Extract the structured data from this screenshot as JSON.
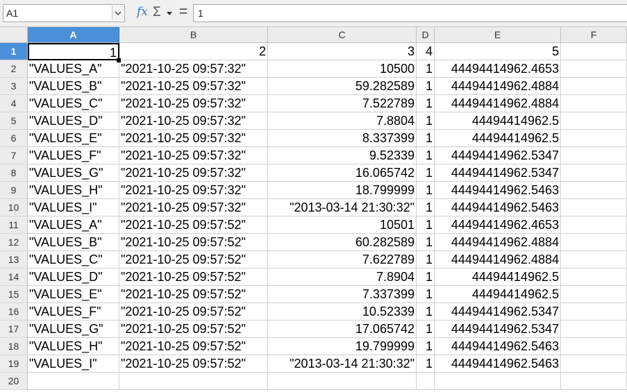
{
  "namebox": {
    "value": "A1",
    "dropdown_icon": "chevron-down-icon"
  },
  "formula": {
    "fx_icon": "function-wizard-icon",
    "fx_label": "fx",
    "sigma_icon": "sum-icon",
    "sigma_label": "Σ",
    "equals_icon": "formula-icon",
    "equals_label": "=",
    "value": "1"
  },
  "columns": [
    "A",
    "B",
    "C",
    "D",
    "E",
    "F"
  ],
  "rows": [
    {
      "num": "1",
      "cells": [
        "1",
        "2",
        "3",
        "4",
        "5",
        ""
      ]
    },
    {
      "num": "2",
      "cells": [
        "\"VALUES_A\"",
        "\"2021-10-25 09:57:32\"",
        "10500",
        "1",
        "44494414962.4653",
        ""
      ]
    },
    {
      "num": "3",
      "cells": [
        "\"VALUES_B\"",
        "\"2021-10-25 09:57:32\"",
        "59.282589",
        "1",
        "44494414962.4884",
        ""
      ]
    },
    {
      "num": "4",
      "cells": [
        "\"VALUES_C\"",
        "\"2021-10-25 09:57:32\"",
        "7.522789",
        "1",
        "44494414962.4884",
        ""
      ]
    },
    {
      "num": "5",
      "cells": [
        "\"VALUES_D\"",
        "\"2021-10-25 09:57:32\"",
        "7.8804",
        "1",
        "44494414962.5",
        ""
      ]
    },
    {
      "num": "6",
      "cells": [
        "\"VALUES_E\"",
        "\"2021-10-25 09:57:32\"",
        "8.337399",
        "1",
        "44494414962.5",
        ""
      ]
    },
    {
      "num": "7",
      "cells": [
        "\"VALUES_F\"",
        "\"2021-10-25 09:57:32\"",
        "9.52339",
        "1",
        "44494414962.5347",
        ""
      ]
    },
    {
      "num": "8",
      "cells": [
        "\"VALUES_G\"",
        "\"2021-10-25 09:57:32\"",
        "16.065742",
        "1",
        "44494414962.5347",
        ""
      ]
    },
    {
      "num": "9",
      "cells": [
        "\"VALUES_H\"",
        "\"2021-10-25 09:57:32\"",
        "18.799999",
        "1",
        "44494414962.5463",
        ""
      ]
    },
    {
      "num": "10",
      "cells": [
        "\"VALUES_I\"",
        "\"2021-10-25 09:57:32\"",
        "\"2013-03-14 21:30:32\"",
        "1",
        "44494414962.5463",
        ""
      ]
    },
    {
      "num": "11",
      "cells": [
        "\"VALUES_A\"",
        "\"2021-10-25 09:57:52\"",
        "10501",
        "1",
        "44494414962.4653",
        ""
      ]
    },
    {
      "num": "12",
      "cells": [
        "\"VALUES_B\"",
        "\"2021-10-25 09:57:52\"",
        "60.282589",
        "1",
        "44494414962.4884",
        ""
      ]
    },
    {
      "num": "13",
      "cells": [
        "\"VALUES_C\"",
        "\"2021-10-25 09:57:52\"",
        "7.622789",
        "1",
        "44494414962.4884",
        ""
      ]
    },
    {
      "num": "14",
      "cells": [
        "\"VALUES_D\"",
        "\"2021-10-25 09:57:52\"",
        "7.8904",
        "1",
        "44494414962.5",
        ""
      ]
    },
    {
      "num": "15",
      "cells": [
        "\"VALUES_E\"",
        "\"2021-10-25 09:57:52\"",
        "7.337399",
        "1",
        "44494414962.5",
        ""
      ]
    },
    {
      "num": "16",
      "cells": [
        "\"VALUES_F\"",
        "\"2021-10-25 09:57:52\"",
        "10.52339",
        "1",
        "44494414962.5347",
        ""
      ]
    },
    {
      "num": "17",
      "cells": [
        "\"VALUES_G\"",
        "\"2021-10-25 09:57:52\"",
        "17.065742",
        "1",
        "44494414962.5347",
        ""
      ]
    },
    {
      "num": "18",
      "cells": [
        "\"VALUES_H\"",
        "\"2021-10-25 09:57:52\"",
        "19.799999",
        "1",
        "44494414962.5463",
        ""
      ]
    },
    {
      "num": "19",
      "cells": [
        "\"VALUES_I\"",
        "\"2021-10-25 09:57:52\"",
        "\"2013-03-14 21:30:32\"",
        "1",
        "44494414962.5463",
        ""
      ]
    },
    {
      "num": "20",
      "cells": [
        "",
        "",
        "",
        "",
        "",
        ""
      ]
    }
  ],
  "selection": {
    "column": "A",
    "row": "1"
  },
  "colors": {
    "header_bg": "#ececec",
    "selected_header": "#4a90d9",
    "grid": "#d0d0d0",
    "toolbar_bg": "#f0f0f0"
  }
}
